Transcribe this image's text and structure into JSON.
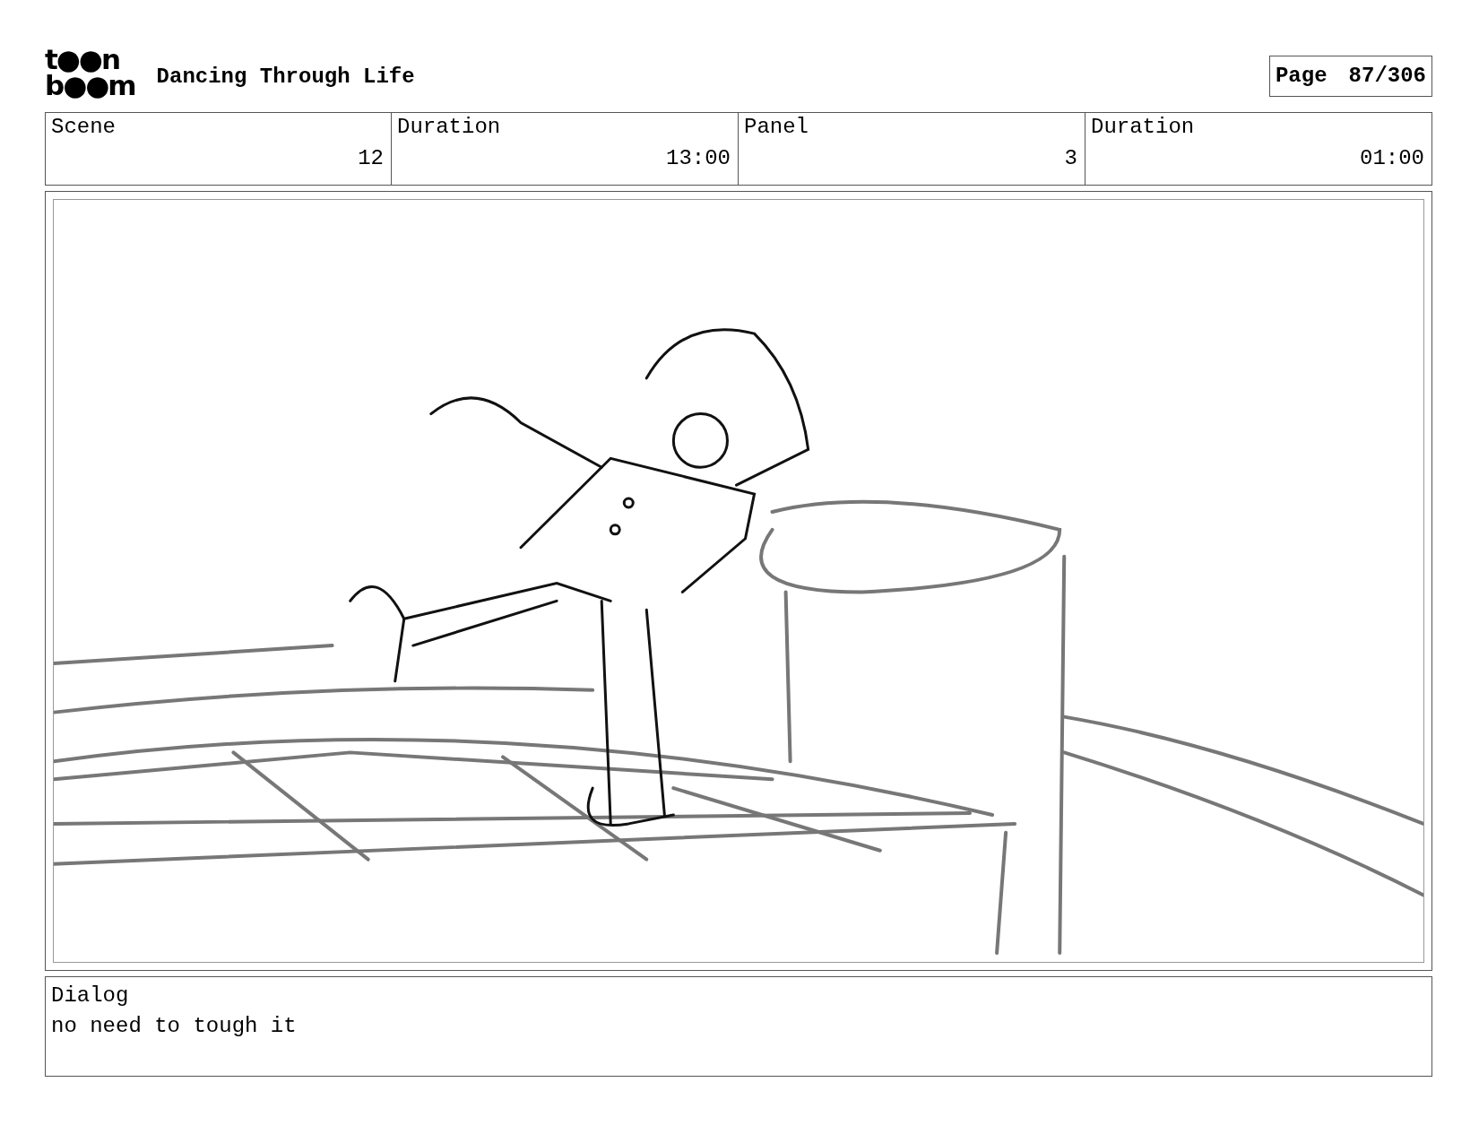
{
  "logo": {
    "line_1": "t●●n",
    "line_2": "b●●m"
  },
  "title": "Dancing Through Life",
  "page": {
    "label": "Page",
    "value": "87/306"
  },
  "fields": [
    {
      "heading": "Scene",
      "entry": "12"
    },
    {
      "heading": "Duration",
      "entry": "13:00"
    },
    {
      "heading": "Panel",
      "entry": "3"
    },
    {
      "heading": "Duration",
      "entry": "01:00"
    }
  ],
  "dialog": {
    "label": "Dialog",
    "text": "no need to tough it"
  }
}
